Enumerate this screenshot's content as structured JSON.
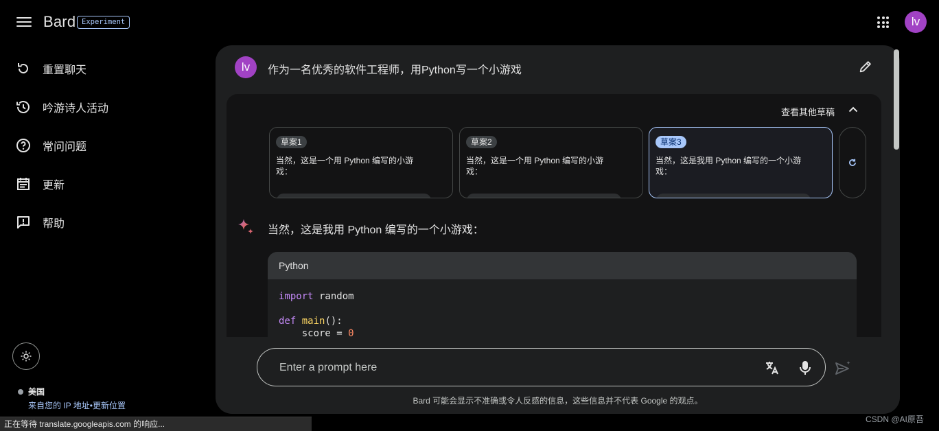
{
  "header": {
    "brand": "Bard",
    "badge": "Experiment",
    "avatar_initials": "lv"
  },
  "sidebar": {
    "items": [
      {
        "label": "重置聊天",
        "icon": "reset-icon"
      },
      {
        "label": "吟游诗人活动",
        "icon": "history-icon"
      },
      {
        "label": "常问问题",
        "icon": "help-circle-icon"
      },
      {
        "label": "更新",
        "icon": "calendar-icon"
      },
      {
        "label": "帮助",
        "icon": "feedback-icon"
      }
    ],
    "location": {
      "country": "美国",
      "from_ip": "来自您的 IP 地址",
      "separator": "•",
      "update": "更新位置"
    }
  },
  "chat": {
    "user_avatar": "lv",
    "question": "作为一名优秀的软件工程师，用Python写一个小游戏",
    "drafts_toggle": "查看其他草稿",
    "drafts": [
      {
        "tag": "草案1",
        "text": "当然，这是一个用 Python 编写的小游戏：",
        "selected": false
      },
      {
        "tag": "草案2",
        "text": "当然，这是一个用 Python 编写的小游戏：",
        "selected": false
      },
      {
        "tag": "草案3",
        "text": "当然，这是我用 Python 编写的一个小游戏：",
        "selected": true
      }
    ],
    "answer_intro": "当然，这是我用 Python 编写的一个小游戏：",
    "code": {
      "language": "Python",
      "line1_kw": "import",
      "line1_rest": " random",
      "line2_kw": "def",
      "line2_fn": "main",
      "line2_rest": "():",
      "line3_var": "    score = ",
      "line3_num": "0"
    }
  },
  "input": {
    "placeholder": "Enter a prompt here",
    "value": ""
  },
  "disclaimer": "Bard 可能会显示不准确或令人反感的信息，这些信息并不代表 Google 的观点。",
  "status_bar": "正在等待 translate.googleapis.com 的响应...",
  "watermark": "CSDN @AI原吾",
  "colors": {
    "accent": "#a8c7fa",
    "avatar": "#a142c4",
    "panel": "#1e1f20",
    "background": "#000000"
  }
}
